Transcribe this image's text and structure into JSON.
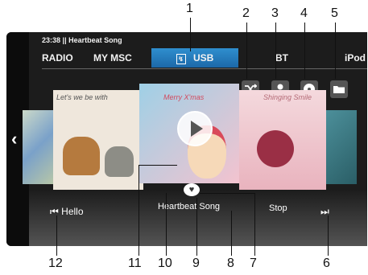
{
  "status": {
    "time": "23:38",
    "separator": "||",
    "song": "Heartbeat Song"
  },
  "tabs": [
    {
      "label": "RADIO"
    },
    {
      "label": "MY MSC"
    },
    {
      "label": "USB",
      "active": true
    },
    {
      "label": "BT"
    },
    {
      "label": "iPod"
    }
  ],
  "controls": {
    "shuffle_icon": "shuffle-icon",
    "artist_icon": "person-icon",
    "album_icon": "disc-icon",
    "folder_icon": "folder-icon"
  },
  "covers": {
    "dog_title": "Let's we be with",
    "center_title": "Merry X'mas",
    "flower_title": "Shinging Smile"
  },
  "labels": {
    "left": "Hello",
    "center": "Heartbeat Song",
    "right": "Stop"
  },
  "callouts": [
    "1",
    "2",
    "3",
    "4",
    "5",
    "6",
    "7",
    "8",
    "9",
    "10",
    "11",
    "12"
  ],
  "colors": {
    "accent": "#2a7fc0",
    "panel": "#1c1c1c"
  }
}
